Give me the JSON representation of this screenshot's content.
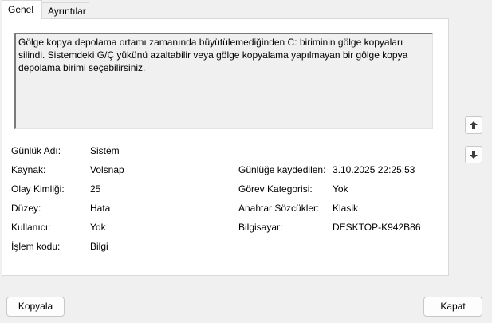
{
  "tabs": [
    {
      "label": "Genel",
      "active": true
    },
    {
      "label": "Ayrıntılar",
      "active": false
    }
  ],
  "description": "Gölge kopya depolama ortamı zamanında büyütülemediğinden C: biriminin gölge kopyaları silindi. Sistemdeki G/Ç yükünü azaltabilir veya gölge kopyalama yapılmayan bir gölge kopya depolama birimi seçebilirsiniz.",
  "fields": {
    "log_name": {
      "label": "Günlük Adı:",
      "value": "Sistem"
    },
    "source": {
      "label": "Kaynak:",
      "value": "Volsnap"
    },
    "event_id": {
      "label": "Olay Kimliği:",
      "value": "25"
    },
    "level": {
      "label": "Düzey:",
      "value": "Hata"
    },
    "user": {
      "label": "Kullanıcı:",
      "value": "Yok"
    },
    "opcode": {
      "label": "İşlem kodu:",
      "value": "Bilgi"
    },
    "logged": {
      "label": "Günlüğe kaydedilen:",
      "value": "3.10.2025 22:25:53"
    },
    "task_category": {
      "label": "Görev Kategorisi:",
      "value": "Yok"
    },
    "keywords": {
      "label": "Anahtar Sözcükler:",
      "value": "Klasik"
    },
    "computer": {
      "label": "Bilgisayar:",
      "value": "DESKTOP-K942B86"
    }
  },
  "nav": {
    "up_icon": "arrow-up-icon",
    "down_icon": "arrow-down-icon"
  },
  "buttons": {
    "copy": "Kopyala",
    "close": "Kapat"
  }
}
